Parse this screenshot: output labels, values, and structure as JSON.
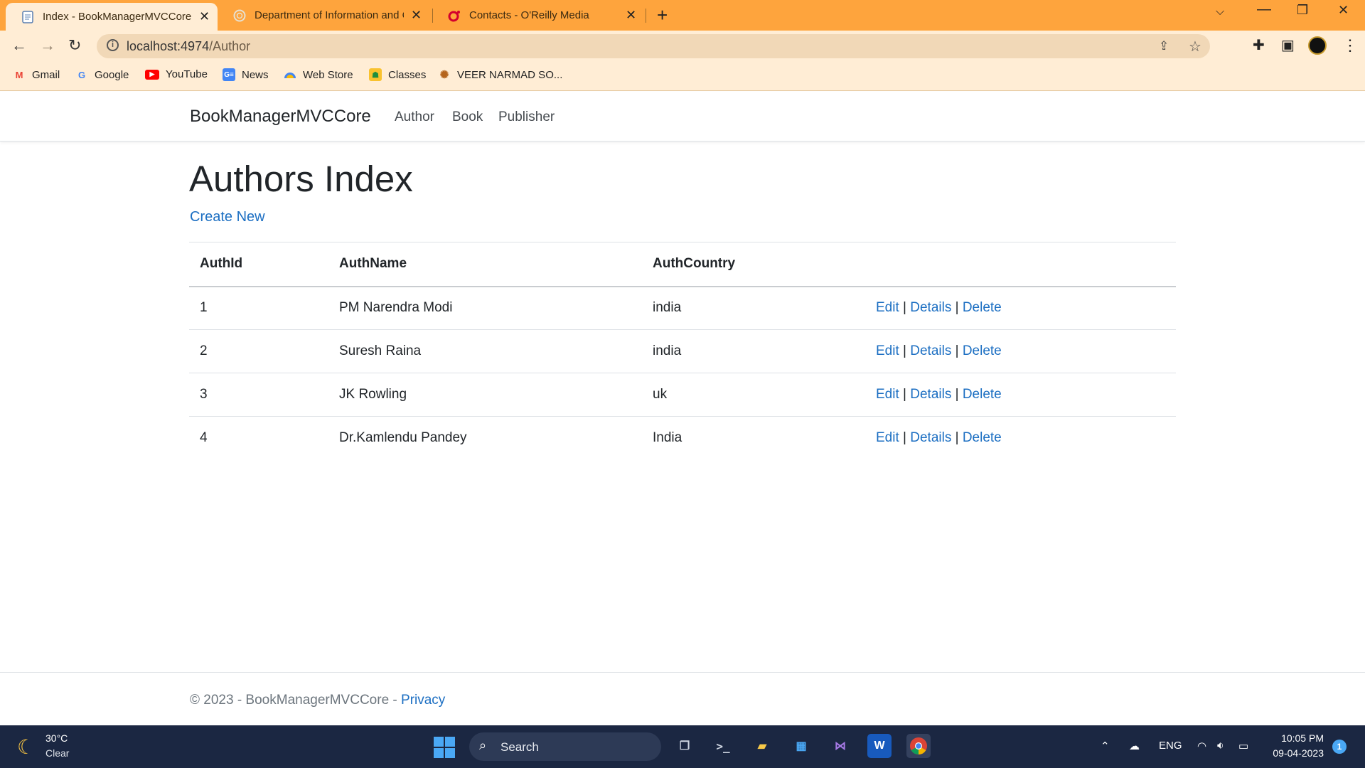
{
  "browser": {
    "tabs": [
      {
        "title": "Index - BookManagerMVCCore",
        "active": true
      },
      {
        "title": "Department of Information and C",
        "active": false
      },
      {
        "title": "Contacts - O'Reilly Media",
        "active": false
      }
    ],
    "address": {
      "host": "localhost:4974",
      "path": "/Author"
    },
    "bookmarks": [
      "Gmail",
      "Google",
      "YouTube",
      "News",
      "Web Store",
      "Classes",
      "VEER NARMAD SO..."
    ]
  },
  "site": {
    "brand": "BookManagerMVCCore",
    "nav": [
      "Author",
      "Book",
      "Publisher"
    ]
  },
  "page": {
    "title": "Authors Index",
    "create_link": "Create New",
    "columns": [
      "AuthId",
      "AuthName",
      "AuthCountry"
    ],
    "rows": [
      {
        "id": "1",
        "name": "PM Narendra Modi",
        "country": "india"
      },
      {
        "id": "2",
        "name": "Suresh Raina",
        "country": "india"
      },
      {
        "id": "3",
        "name": "JK Rowling",
        "country": "uk"
      },
      {
        "id": "4",
        "name": "Dr.Kamlendu Pandey",
        "country": "India"
      }
    ],
    "actions": {
      "edit": "Edit",
      "details": "Details",
      "delete": "Delete",
      "separator": "|"
    }
  },
  "footer": {
    "text": "© 2023 - BookManagerMVCCore - ",
    "privacy": "Privacy"
  },
  "taskbar": {
    "weather_temp": "30°C",
    "weather_cond": "Clear",
    "search_label": "Search",
    "language": "ENG",
    "time": "10:05 PM",
    "date": "09-04-2023",
    "notifications": "1"
  },
  "colors": {
    "tabstrip": "#fea43d",
    "toolbar": "#ffedd5",
    "link": "#1b6ec2",
    "taskbar": "#1b2742"
  }
}
